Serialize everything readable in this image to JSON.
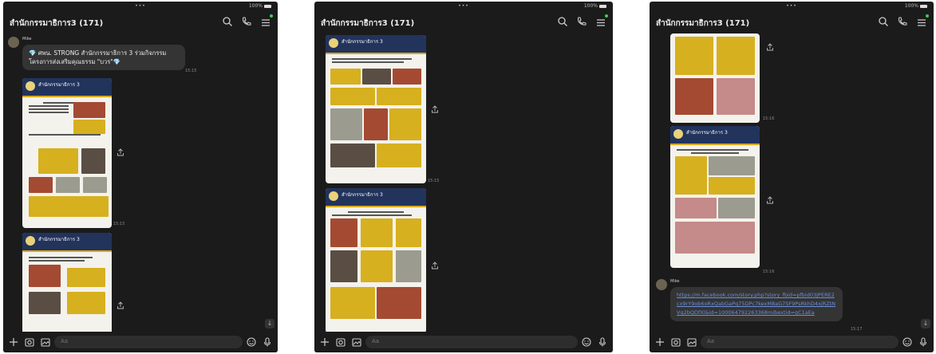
{
  "panel1": {
    "status_dots": "•••",
    "status_right": "100%",
    "title": "สำนักกรรมาธิการ3 (171)",
    "sender": "Mike",
    "message": "💎 ศพน. STRONG สำนักกรรมาธิการ 3 ร่วมกิจกรรมโครงการส่งเสริมคุณธรรม \"บวร\"💎",
    "message_time": "15:15",
    "card1_title": "สำนักกรรมาธิการ 3",
    "card1_time": "15:15",
    "card2_title": "สำนักกรรมาธิการ 3",
    "input_placeholder": "Aa"
  },
  "panel2": {
    "status_dots": "•••",
    "status_right": "100%",
    "title": "สำนักกรรมาธิการ3 (171)",
    "card1_title": "สำนักกรรมาธิการ 3",
    "card1_time": "15:15",
    "card2_title": "สำนักกรรมาธิการ 3",
    "input_placeholder": "Aa"
  },
  "panel3": {
    "status_dots": "•••",
    "status_right": "100%",
    "title": "สำนักกรรมาธิการ3 (171)",
    "card1_time": "15:16",
    "card2_title": "สำนักกรรมาธิการ 3",
    "card2_time": "15:16",
    "sender": "Mike",
    "link": "https://m.facebook.com/story.php?story_fbid=pfbid03JPERE2cx9rY9ob6oRxQabGaPq75DPc7kexM8aG7SF9PsRkhD4xjRZtNVq2bQDfXl&id=100064792263368mibextid=qC1aEa",
    "link_time": "15:17",
    "input_placeholder": "Aa"
  },
  "colors": {
    "bg": "#1b1b1b",
    "accent_green": "#3ecb54",
    "link": "#6a8fdc",
    "card_header": "#22335c"
  }
}
